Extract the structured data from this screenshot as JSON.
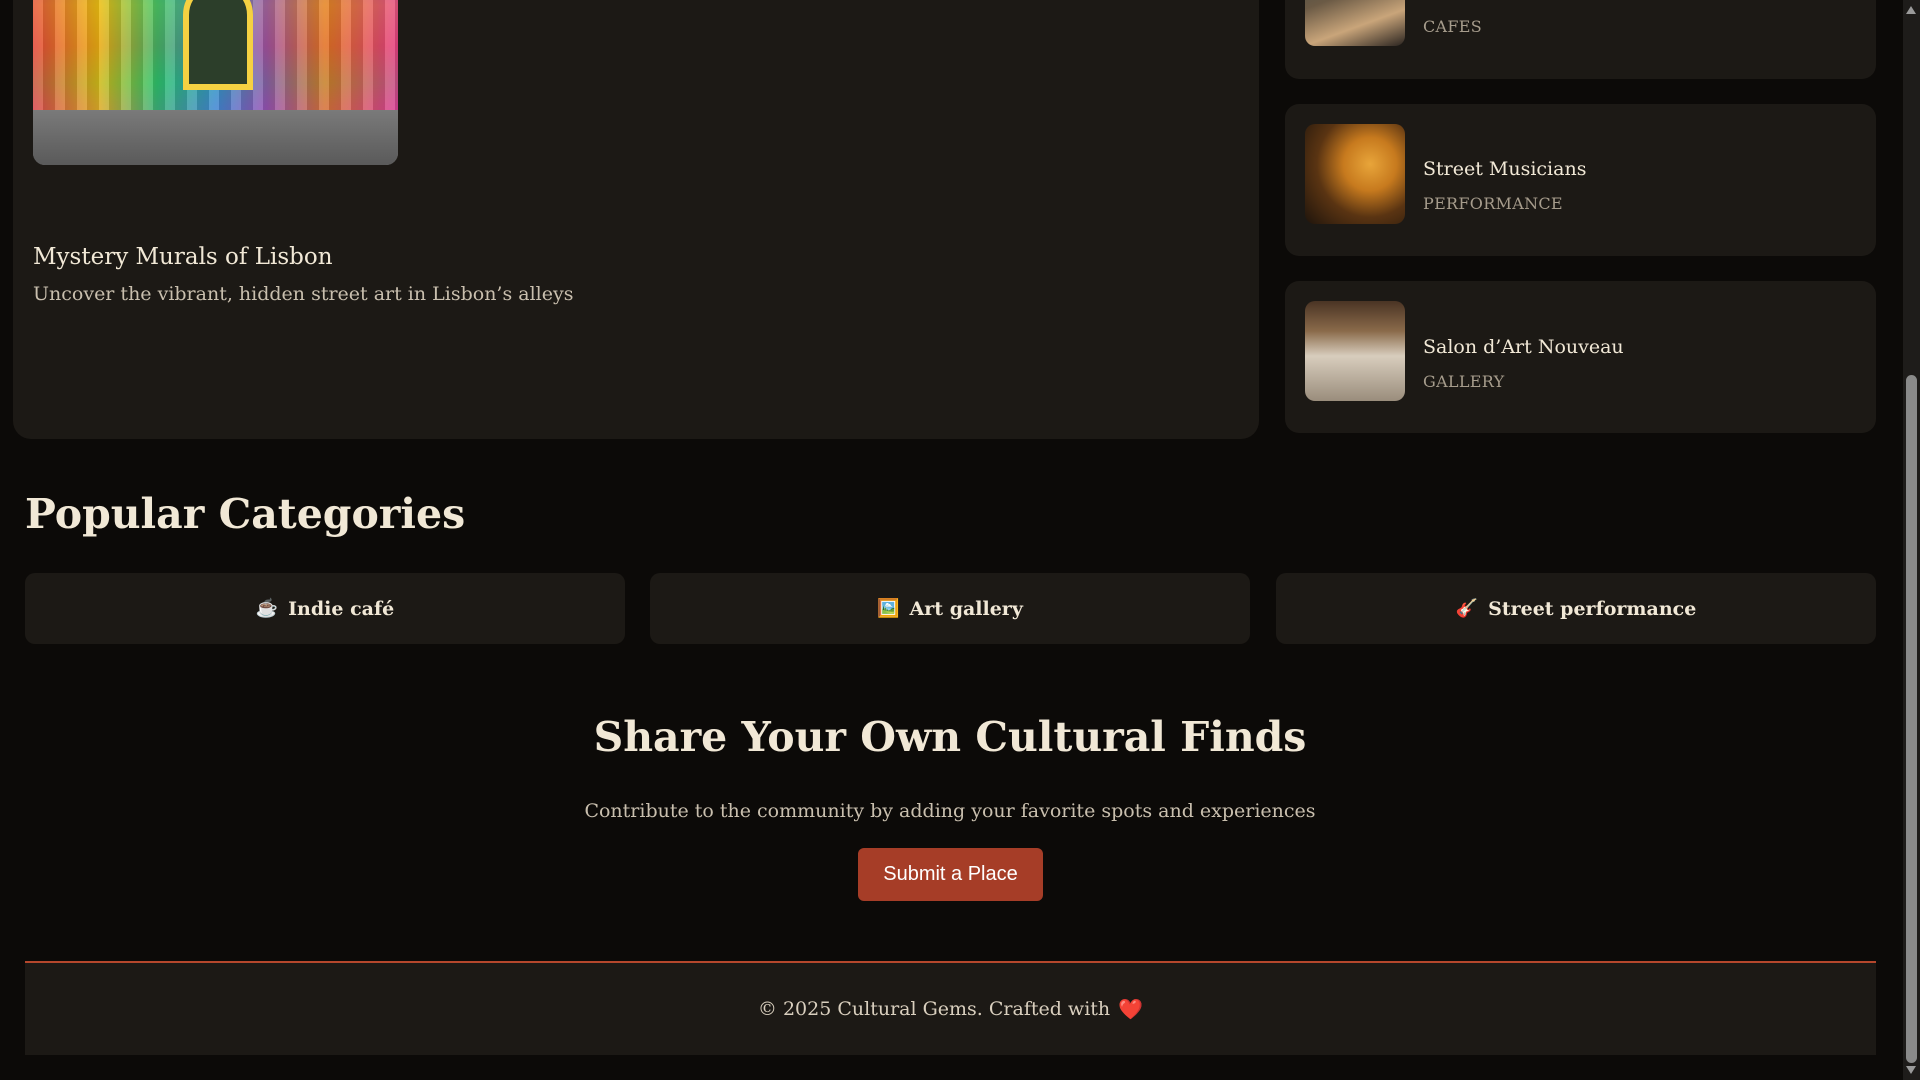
{
  "featured": {
    "title": "Mystery Murals of Lisbon",
    "description": "Uncover the vibrant, hidden street art in Lisbon’s alleys"
  },
  "places": [
    {
      "name": "",
      "category": "CAFES",
      "image": "cafe-interior"
    },
    {
      "name": "Street Musicians",
      "category": "PERFORMANCE",
      "image": "musicians-performing"
    },
    {
      "name": "Salon d’Art Nouveau",
      "category": "GALLERY",
      "image": "gallery-room"
    }
  ],
  "popular": {
    "title": "Popular Categories",
    "categories": [
      {
        "icon": "☕",
        "icon_name": "coffee-icon",
        "label": "Indie café"
      },
      {
        "icon": "🖼️",
        "icon_name": "picture-icon",
        "label": "Art gallery"
      },
      {
        "icon": "🎸",
        "icon_name": "guitar-icon",
        "label": "Street performance"
      }
    ]
  },
  "share": {
    "title": "Share Your Own Cultural Finds",
    "description": "Contribute to the community by adding your favorite spots and experiences",
    "button_label": "Submit a Place"
  },
  "footer": {
    "text": "© 2025 Cultural Gems. Crafted with",
    "heart": "❤️"
  },
  "colors": {
    "background": "#0c0a08",
    "card": "#1c1915",
    "accent": "#a63d27",
    "text": "#f1e8d6"
  }
}
